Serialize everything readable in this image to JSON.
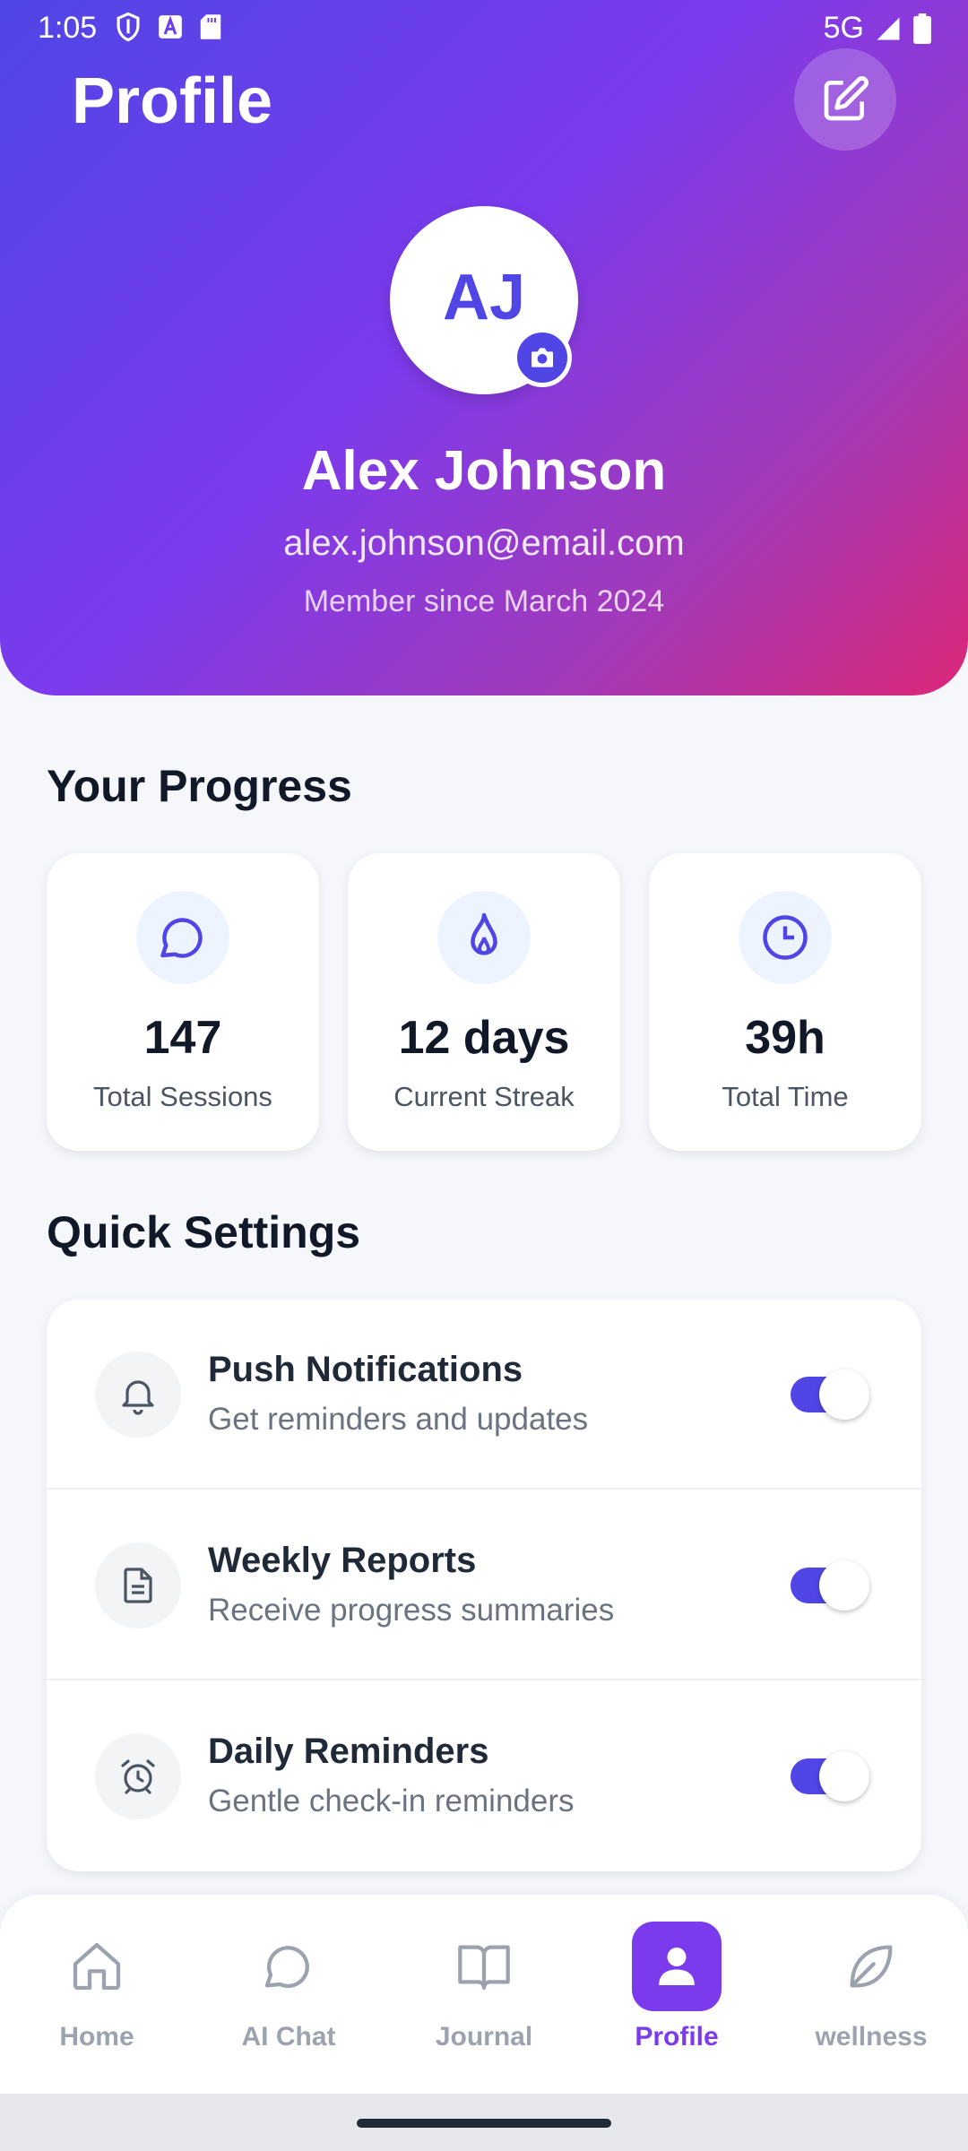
{
  "status_bar": {
    "time": "1:05",
    "network": "5G"
  },
  "header": {
    "title": "Profile"
  },
  "profile": {
    "initials": "AJ",
    "name": "Alex Johnson",
    "email": "alex.johnson@email.com",
    "member_since": "Member since March 2024"
  },
  "progress": {
    "title": "Your Progress",
    "stats": [
      {
        "icon": "chat-icon",
        "value": "147",
        "label": "Total Sessions"
      },
      {
        "icon": "flame-icon",
        "value": "12 days",
        "label": "Current Streak"
      },
      {
        "icon": "clock-icon",
        "value": "39h",
        "label": "Total Time"
      }
    ]
  },
  "settings": {
    "title": "Quick Settings",
    "items": [
      {
        "icon": "bell-icon",
        "title": "Push Notifications",
        "subtitle": "Get reminders and updates",
        "enabled": true
      },
      {
        "icon": "document-icon",
        "title": "Weekly Reports",
        "subtitle": "Receive progress summaries",
        "enabled": true
      },
      {
        "icon": "alarm-icon",
        "title": "Daily Reminders",
        "subtitle": "Gentle check-in reminders",
        "enabled": true
      }
    ]
  },
  "nav": {
    "items": [
      {
        "icon": "home-icon",
        "label": "Home",
        "active": false
      },
      {
        "icon": "chat-icon",
        "label": "AI Chat",
        "active": false
      },
      {
        "icon": "book-icon",
        "label": "Journal",
        "active": false
      },
      {
        "icon": "person-icon",
        "label": "Profile",
        "active": true
      },
      {
        "icon": "leaf-icon",
        "label": "wellness",
        "active": false
      }
    ]
  },
  "colors": {
    "accent": "#4f46e5",
    "accent_purple": "#7c3aed",
    "gradient_end": "#db2777"
  }
}
